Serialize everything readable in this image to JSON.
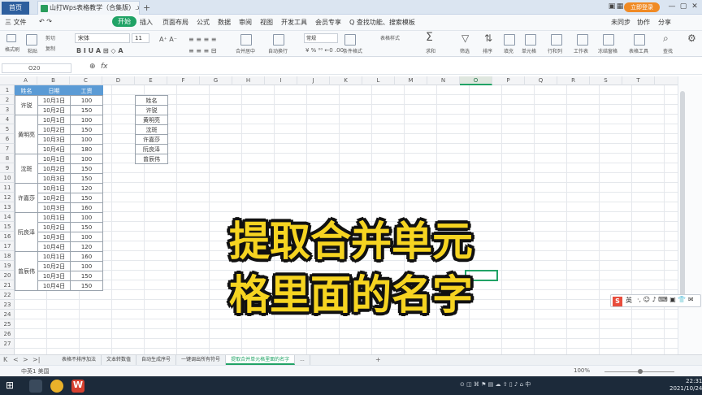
{
  "titlebar": {
    "home": "首页",
    "doc": "山打Wps表格教学（合集版）.xlsx",
    "login": "立即登录"
  },
  "menu": [
    "三 文件",
    "开始",
    "插入",
    "页面布局",
    "公式",
    "数据",
    "审阅",
    "视图",
    "开发工具",
    "会员专享",
    "Q 查找功能、搜索模板"
  ],
  "menu_right": [
    "未同步",
    "协作",
    "分享"
  ],
  "ribbon": {
    "font": "宋体",
    "size": "11",
    "numfmt": "常规",
    "labels": [
      "格式刷",
      "粘贴",
      "剪切",
      "复制",
      "合并居中",
      "自动换行",
      "条件格式",
      "表格样式",
      "求和",
      "筛选",
      "排序",
      "填充",
      "单元格",
      "行和列",
      "工作表",
      "冻结窗格",
      "表格工具",
      "查找"
    ]
  },
  "formula": {
    "cell": "O20",
    "fx": "fx"
  },
  "columns": [
    "A",
    "B",
    "C",
    "D",
    "E",
    "F",
    "G",
    "H",
    "I",
    "J",
    "K",
    "L",
    "M",
    "N",
    "O",
    "P",
    "Q",
    "R",
    "S",
    "T"
  ],
  "rows": [
    "1",
    "2",
    "3",
    "4",
    "5",
    "6",
    "7",
    "8",
    "9",
    "10",
    "11",
    "12",
    "13",
    "14",
    "15",
    "16",
    "17",
    "18",
    "19",
    "20",
    "21",
    "22",
    "23",
    "24",
    "25",
    "26",
    "27"
  ],
  "table": {
    "headers": [
      "姓名",
      "日期",
      "工资"
    ],
    "dates": [
      "10月1日",
      "10月2日",
      "10月1日",
      "10月2日",
      "10月3日",
      "10月4日",
      "10月1日",
      "10月2日",
      "10月3日",
      "10月1日",
      "10月2日",
      "10月3日",
      "10月1日",
      "10月2日",
      "10月3日",
      "10月4日",
      "10月1日",
      "10月2日",
      "10月3日",
      "10月4日"
    ],
    "pay": [
      "100",
      "150",
      "100",
      "150",
      "100",
      "180",
      "100",
      "150",
      "150",
      "120",
      "150",
      "160",
      "100",
      "150",
      "100",
      "120",
      "160",
      "100",
      "150",
      "150"
    ],
    "names": [
      "许锐",
      "黄明亮",
      "沈斑",
      "许嘉莎",
      "阮良泽",
      "曾辰伟"
    ]
  },
  "lookup": {
    "header": "姓名",
    "names": [
      "许锐",
      "黄明亮",
      "沈斑",
      "许嘉莎",
      "阮良泽",
      "曾辰伟"
    ]
  },
  "overlay": [
    "提取合并单元",
    "格里面的名字"
  ],
  "ime": "英",
  "sheets": [
    "表格不排序加法",
    "文本转数值",
    "自动生成序号",
    "一键调出所有符号",
    "提取合并单元格里面的名字",
    "..."
  ],
  "status": {
    "left": "中英1 美国",
    "zoom": "100%"
  },
  "clock": {
    "time": "22:31",
    "date": "2021/10/24"
  }
}
